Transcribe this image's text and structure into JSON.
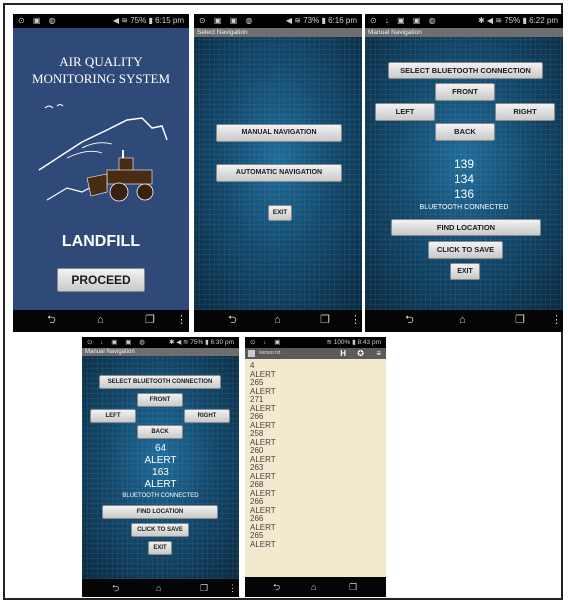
{
  "screen1": {
    "status": {
      "left": "⊙ ▣ ◍",
      "right": "◀ ≋ 75% ▮ 6:15 pm"
    },
    "title_line1": "AIR QUALITY",
    "title_line2": "MONITORING SYSTEM",
    "landfill": "LANDFILL",
    "proceed": "PROCEED"
  },
  "screen2": {
    "status": {
      "left": "⊙ ▣ ▣ ◍",
      "right": "◀ ≋ 73% ▮ 6:16 pm"
    },
    "title": "Select Navigation",
    "manual": "MANUAL NAVIGATION",
    "automatic": "AUTOMATIC NAVIGATION",
    "exit": "EXIT"
  },
  "screen3": {
    "status": {
      "left": "⊙ ↓ ▣ ▣ ◍",
      "right": "✱ ◀ ≋ 75% ▮ 6:22 pm"
    },
    "title": "Manual Navigation",
    "bluetooth": "SELECT BLUETOOTH CONNECTION",
    "front": "FRONT",
    "left": "LEFT",
    "right": "RIGHT",
    "back": "BACK",
    "values": [
      "139",
      "134",
      "136"
    ],
    "connected": "BLUETOOTH CONNECTED",
    "find": "FIND LOCATION",
    "save": "CLICK TO SAVE",
    "exit": "EXIT"
  },
  "screen4": {
    "status": {
      "left": "⊙ ↓ ▣ ▣ ◍",
      "right": "✱ ◀ ≋ 75% ▮ 6:30 pm"
    },
    "title": "Manual Navigation",
    "bluetooth": "SELECT BLUETOOTH CONNECTION",
    "front": "FRONT",
    "left": "LEFT",
    "right": "RIGHT",
    "back": "BACK",
    "values": [
      "64",
      "ALERT",
      "163",
      "ALERT"
    ],
    "connected": "BLUETOOTH CONNECTED",
    "find": "FIND LOCATION",
    "save": "CLICK TO SAVE",
    "exit": "EXIT"
  },
  "screen5": {
    "status": {
      "left": "⊙ ↓ ▣",
      "right": "≋ 100% ▮ 8:43 pm"
    },
    "app_title": "sensor.txt",
    "lines": [
      "4",
      "ALERT",
      "265",
      "ALERT",
      "271",
      "ALERT",
      "266",
      "ALERT",
      "258",
      "ALERT",
      "260",
      "ALERT",
      "263",
      "ALERT",
      "268",
      "ALERT",
      "266",
      "ALERT",
      "266",
      "ALERT",
      "265",
      "ALERT"
    ]
  },
  "navbar": {
    "back": "⮌",
    "home": "⌂",
    "recents": "❐",
    "menu": "⋮"
  }
}
